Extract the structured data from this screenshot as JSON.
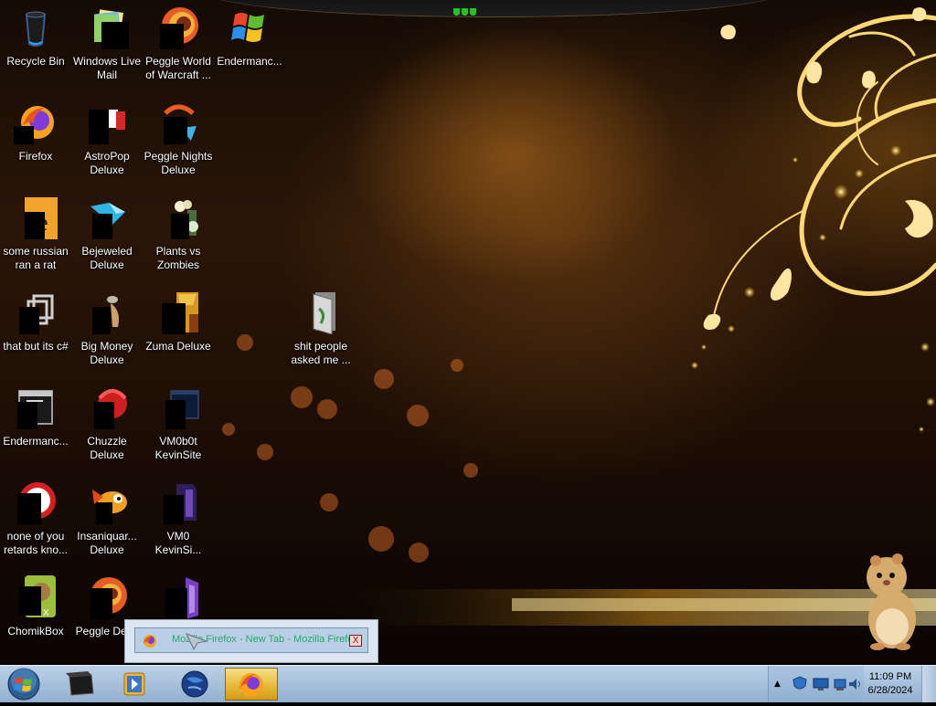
{
  "desktop": {
    "icons": [
      {
        "label": "Recycle Bin",
        "icon": "recycle-bin-icon"
      },
      {
        "label": "Windows Live Mail",
        "icon": "folder-mail-icon"
      },
      {
        "label": "Peggle World of Warcraft ...",
        "icon": "peggle-unicorn-icon"
      },
      {
        "label": "Endermanc...",
        "icon": "windows-logo-icon"
      },
      {
        "label": "Firefox",
        "icon": "firefox-icon"
      },
      {
        "label": "AstroPop Deluxe",
        "icon": "astropop-icon"
      },
      {
        "label": "Peggle Nights Deluxe",
        "icon": "peggle-nights-icon"
      },
      {
        "label": "some russian ran a rat",
        "icon": "orange-e-icon"
      },
      {
        "label": "Bejeweled Deluxe",
        "icon": "bejeweled-icon"
      },
      {
        "label": "Plants vs Zombies",
        "icon": "plants-vs-zombies-icon"
      },
      {
        "label": "that but its c#",
        "icon": "shortcut-windows-icon"
      },
      {
        "label": "Big Money Deluxe",
        "icon": "big-money-icon"
      },
      {
        "label": "Zuma Deluxe",
        "icon": "zuma-icon"
      },
      {
        "label": "shit people asked me ...",
        "icon": "folder-icon"
      },
      {
        "label": "Endermanc...",
        "icon": "console-window-icon"
      },
      {
        "label": "Chuzzle Deluxe",
        "icon": "chuzzle-icon"
      },
      {
        "label": "VM0b0t KevinSite",
        "icon": "dark-window-icon"
      },
      {
        "label": "none of you retards kno...",
        "icon": "red-white-round-icon"
      },
      {
        "label": "Insaniquar... Deluxe",
        "icon": "insaniquarium-fish-icon"
      },
      {
        "label": "VM0 KevinSi...",
        "icon": "purple-document-icon"
      },
      {
        "label": "ChomikBox",
        "icon": "chomikbox-hamster-icon"
      },
      {
        "label": "Peggle Del...",
        "icon": "peggle-deluxe-icon"
      },
      {
        "label": "",
        "icon": "visual-studio-icon"
      }
    ]
  },
  "notification": {
    "text": "Mozilla Firefox - New Tab - Mozilla Firefox",
    "close_label": "X",
    "icon": "firefox-icon",
    "cursor": "mouse-cursor-icon",
    "text_color": "#29a86a"
  },
  "taskbar": {
    "start_label": "Start",
    "pinned": [
      {
        "name": "black-box-program",
        "icon": "dark-box-icon"
      },
      {
        "name": "windows-media-player",
        "icon": "media-player-icon"
      },
      {
        "name": "network-globe",
        "icon": "globe-icon"
      },
      {
        "name": "firefox",
        "icon": "firefox-icon",
        "active": true
      }
    ],
    "tray": {
      "expand_label": "▲",
      "icons": [
        "shield-icon",
        "monitor-icon",
        "network-icon",
        "volume-icon"
      ]
    },
    "clock": {
      "time": "11:09 PM",
      "date": "6/28/2024"
    }
  },
  "colors": {
    "taskbar": "#a9c2dd",
    "accent_gold": "#f5c54a",
    "active_button": "#e7b93b"
  }
}
